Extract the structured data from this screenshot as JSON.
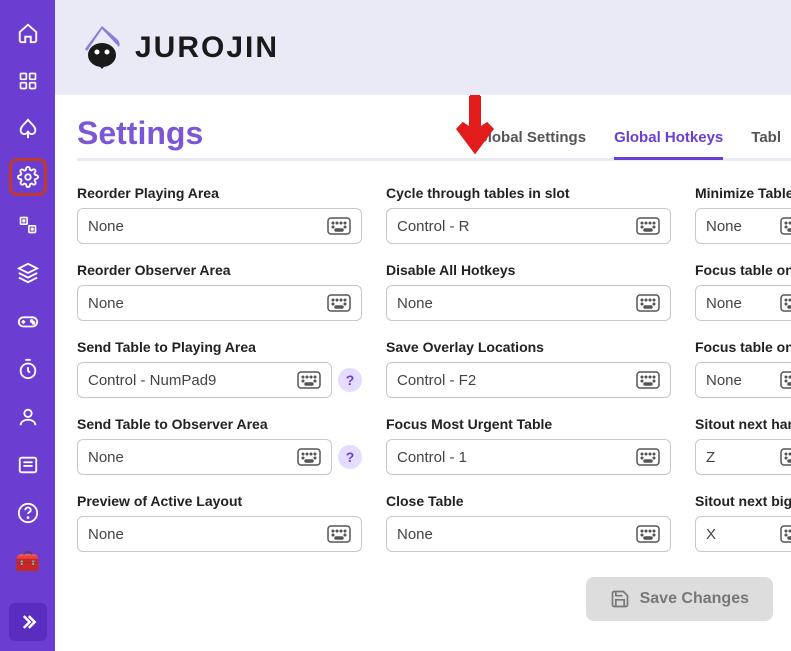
{
  "app_name": "JUROJIN",
  "page_title": "Settings",
  "tabs": {
    "global_settings": "Global Settings",
    "global_hotkeys": "Global Hotkeys",
    "table": "Tabl"
  },
  "save_button": "Save Changes",
  "sidebar": {
    "items": [
      "home",
      "apps",
      "spade",
      "settings",
      "casino",
      "layers",
      "gamepad",
      "timer",
      "profile",
      "news",
      "help",
      "chest"
    ]
  },
  "col1": [
    {
      "label": "Reorder Playing Area",
      "value": "None",
      "help": false
    },
    {
      "label": "Reorder Observer Area",
      "value": "None",
      "help": false
    },
    {
      "label": "Send Table to Playing Area",
      "value": "Control - NumPad9",
      "help": true
    },
    {
      "label": "Send Table to Observer Area",
      "value": "None",
      "help": true
    },
    {
      "label": "Preview of Active Layout",
      "value": "None",
      "help": false
    }
  ],
  "col2": [
    {
      "label": "Cycle through tables in slot",
      "value": "Control - R",
      "help": false
    },
    {
      "label": "Disable All Hotkeys",
      "value": "None",
      "help": false
    },
    {
      "label": "Save Overlay Locations",
      "value": "Control - F2",
      "help": false
    },
    {
      "label": "Focus Most Urgent Table",
      "value": "Control - 1",
      "help": false
    },
    {
      "label": "Close Table",
      "value": "None",
      "help": false
    }
  ],
  "col3": [
    {
      "label": "Minimize Table",
      "value": "None"
    },
    {
      "label": "Focus table on",
      "value": "None"
    },
    {
      "label": "Focus table on",
      "value": "None"
    },
    {
      "label": "Sitout next han",
      "value": "Z"
    },
    {
      "label": "Sitout next big",
      "value": "X"
    }
  ]
}
